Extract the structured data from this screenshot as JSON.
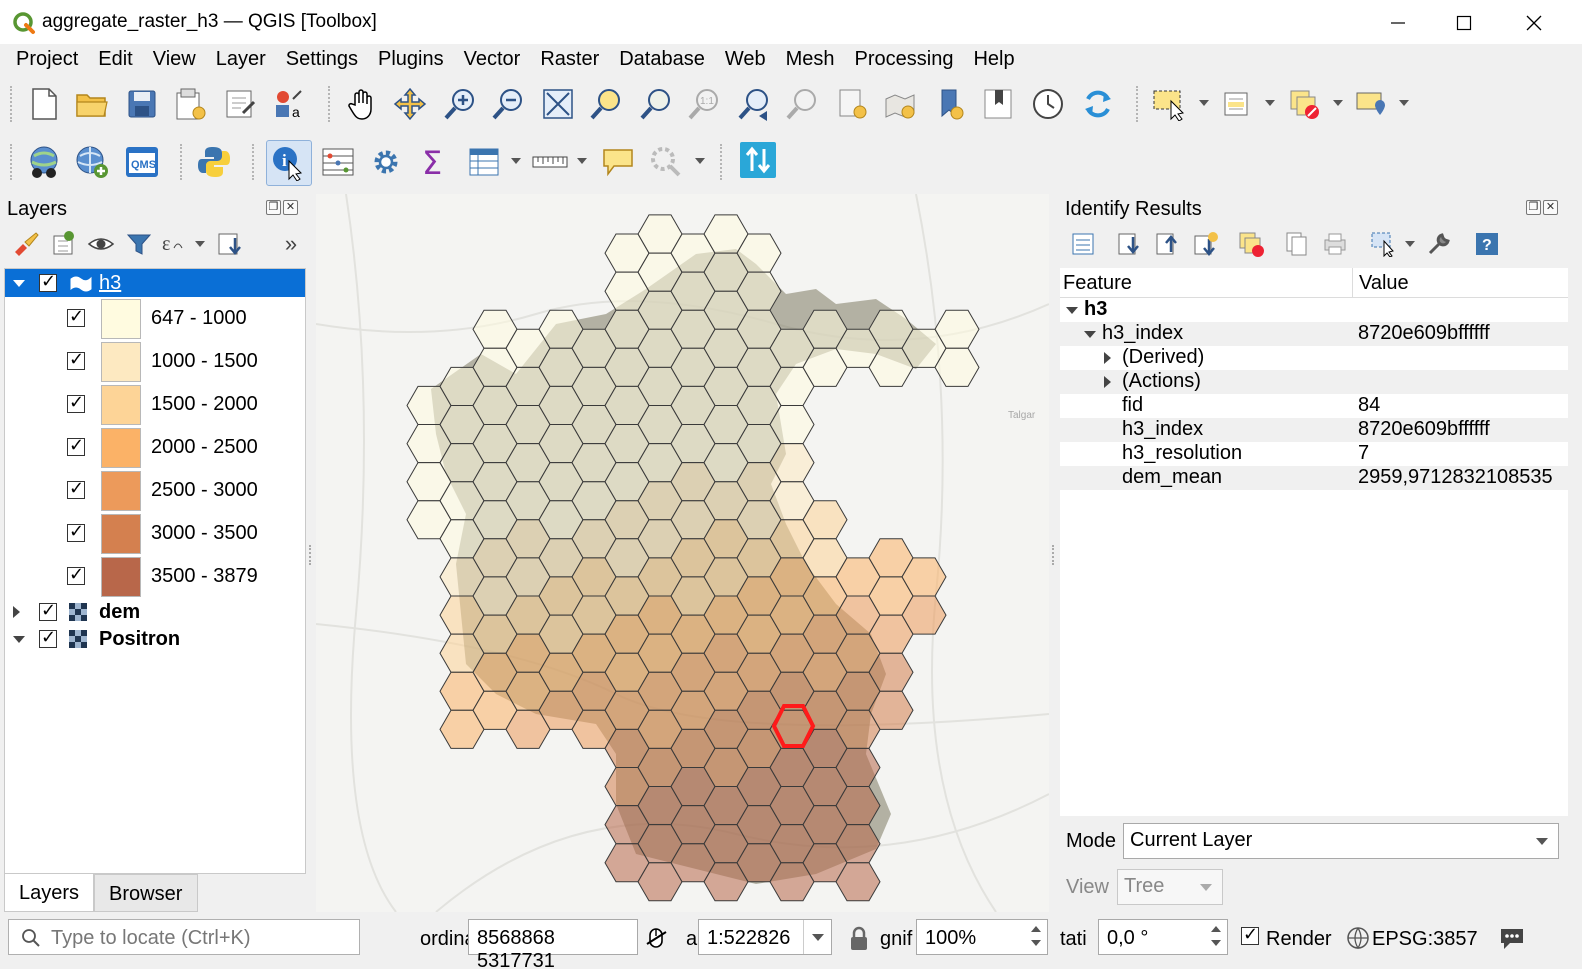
{
  "window": {
    "title": "aggregate_raster_h3 — QGIS [Toolbox]"
  },
  "menu": [
    "Project",
    "Edit",
    "View",
    "Layer",
    "Settings",
    "Plugins",
    "Vector",
    "Raster",
    "Database",
    "Web",
    "Mesh",
    "Processing",
    "Help"
  ],
  "layers_panel": {
    "title": "Layers",
    "layers": [
      {
        "name": "h3",
        "checked": true,
        "expanded": true,
        "selected": true
      },
      {
        "name": "dem",
        "checked": true,
        "expanded": false
      },
      {
        "name": "Positron",
        "checked": true,
        "expanded": true
      }
    ],
    "legend": [
      {
        "label": "647 - 1000",
        "color": "#fffbe0"
      },
      {
        "label": "1000 - 1500",
        "color": "#fde9c1"
      },
      {
        "label": "1500 - 2000",
        "color": "#fdd497"
      },
      {
        "label": "2000 - 2500",
        "color": "#fbb267"
      },
      {
        "label": "2500 - 3000",
        "color": "#ec9a5b"
      },
      {
        "label": "3000 - 3500",
        "color": "#d4804f"
      },
      {
        "label": "3500 - 3879",
        "color": "#b8674a"
      }
    ],
    "tabs": [
      "Layers",
      "Browser"
    ]
  },
  "map": {
    "labels": [
      "Talgar"
    ],
    "selected_fill": "#ff1a1a"
  },
  "identify": {
    "title": "Identify Results",
    "columns": [
      "Feature",
      "Value"
    ],
    "rows": [
      {
        "key": "h3",
        "value": ""
      },
      {
        "key": "h3_index",
        "value": "8720e609bffffff"
      },
      {
        "key": "(Derived)",
        "value": ""
      },
      {
        "key": "(Actions)",
        "value": ""
      },
      {
        "key": "fid",
        "value": "84"
      },
      {
        "key": "h3_index",
        "value": "8720e609bffffff"
      },
      {
        "key": "h3_resolution",
        "value": "7"
      },
      {
        "key": "dem_mean",
        "value": "2959,9712832108535"
      }
    ],
    "mode_label": "Mode",
    "mode_value": "Current Layer",
    "view_label": "View",
    "view_value": "Tree"
  },
  "statusbar": {
    "locate_placeholder": "Type to locate (Ctrl+K)",
    "coord_label": "ordina",
    "coord_value": "8568868  5317731",
    "scale_label": "a",
    "scale_value": "1:522826",
    "magnifier_label": "gnif",
    "magnifier_value": "100%",
    "rotation_label": "tati",
    "rotation_value": "0,0 °",
    "render_label": "Render",
    "crs": "EPSG:3857"
  }
}
